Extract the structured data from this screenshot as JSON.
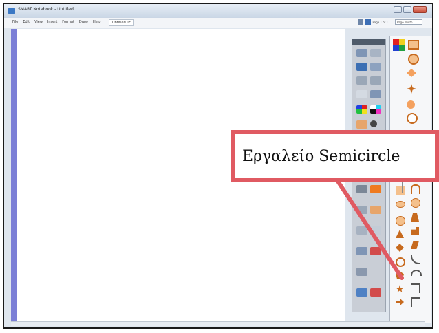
{
  "window": {
    "title": "SMART Notebook - Untitled"
  },
  "menubar": {
    "items": [
      "File",
      "Edit",
      "View",
      "Insert",
      "Format",
      "Draw",
      "Help"
    ],
    "tab": "Untitled 1*",
    "page_info": "Page 1 of 1",
    "zoom": "Page Width"
  },
  "colors": {
    "accent": "#e05a62",
    "canvas_strip": "#7b7fd6",
    "shape_fill": "#f4c08c",
    "shape_stroke": "#c76a1e"
  },
  "callout": {
    "label": "Εργαλείο Semicircle"
  },
  "shape_icons": [
    "rounded-rectangle-icon",
    "arch-icon",
    "ellipse-icon",
    "smiley-icon",
    "circle-icon",
    "trapezoid-icon",
    "triangle-icon",
    "puzzle-icon",
    "diamond-icon",
    "parallelogram-icon",
    "donut-icon",
    "curve-icon",
    "pentagon-icon",
    "semicircle-icon",
    "star-icon",
    "step-icon",
    "arrow-right-icon",
    "corner-icon"
  ]
}
